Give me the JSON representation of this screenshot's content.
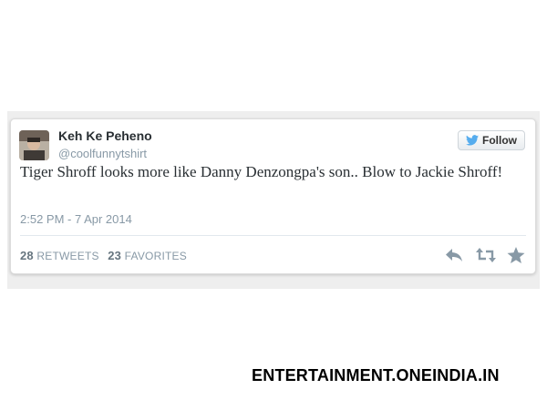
{
  "tweet": {
    "author": {
      "name": "Keh Ke Peheno",
      "handle": "@coolfunnytshirt",
      "avatar_icon": "profile-photo"
    },
    "follow_label": "Follow",
    "text": "Tiger Shroff looks more like Danny Denzongpa's son.. Blow to Jackie Shroff!",
    "timestamp": "2:52 PM - 7 Apr 2014",
    "stats": {
      "retweets_count": "28",
      "retweets_label": "RETWEETS",
      "favorites_count": "23",
      "favorites_label": "FAVORITES"
    },
    "actions": [
      "reply-icon",
      "retweet-icon",
      "favorite-icon"
    ]
  },
  "watermark": "ENTERTAINMENT.ONEINDIA.IN",
  "colors": {
    "twitter_blue": "#55acee",
    "action_gray": "#8899a6",
    "text": "#292f33"
  }
}
